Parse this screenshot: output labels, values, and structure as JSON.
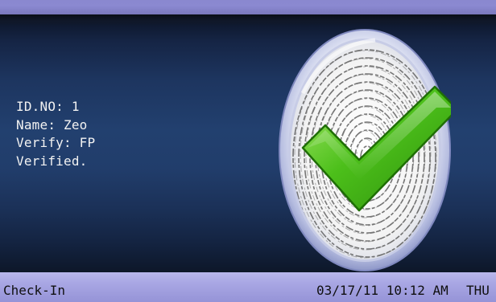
{
  "verification": {
    "id_line": "ID.NO: 1",
    "name_line": "Name: Zeo",
    "verify_line": "Verify: FP",
    "result_line": "Verified."
  },
  "status_bar": {
    "mode": "Check-In",
    "datetime": "03/17/11 10:12 AM",
    "weekday": "THU"
  },
  "icons": {
    "badge": "fingerprint-icon",
    "check": "checkmark-icon"
  },
  "colors": {
    "status_bar": "#a9a7e4",
    "background": "#1d355f",
    "check_green": "#3cae14"
  }
}
